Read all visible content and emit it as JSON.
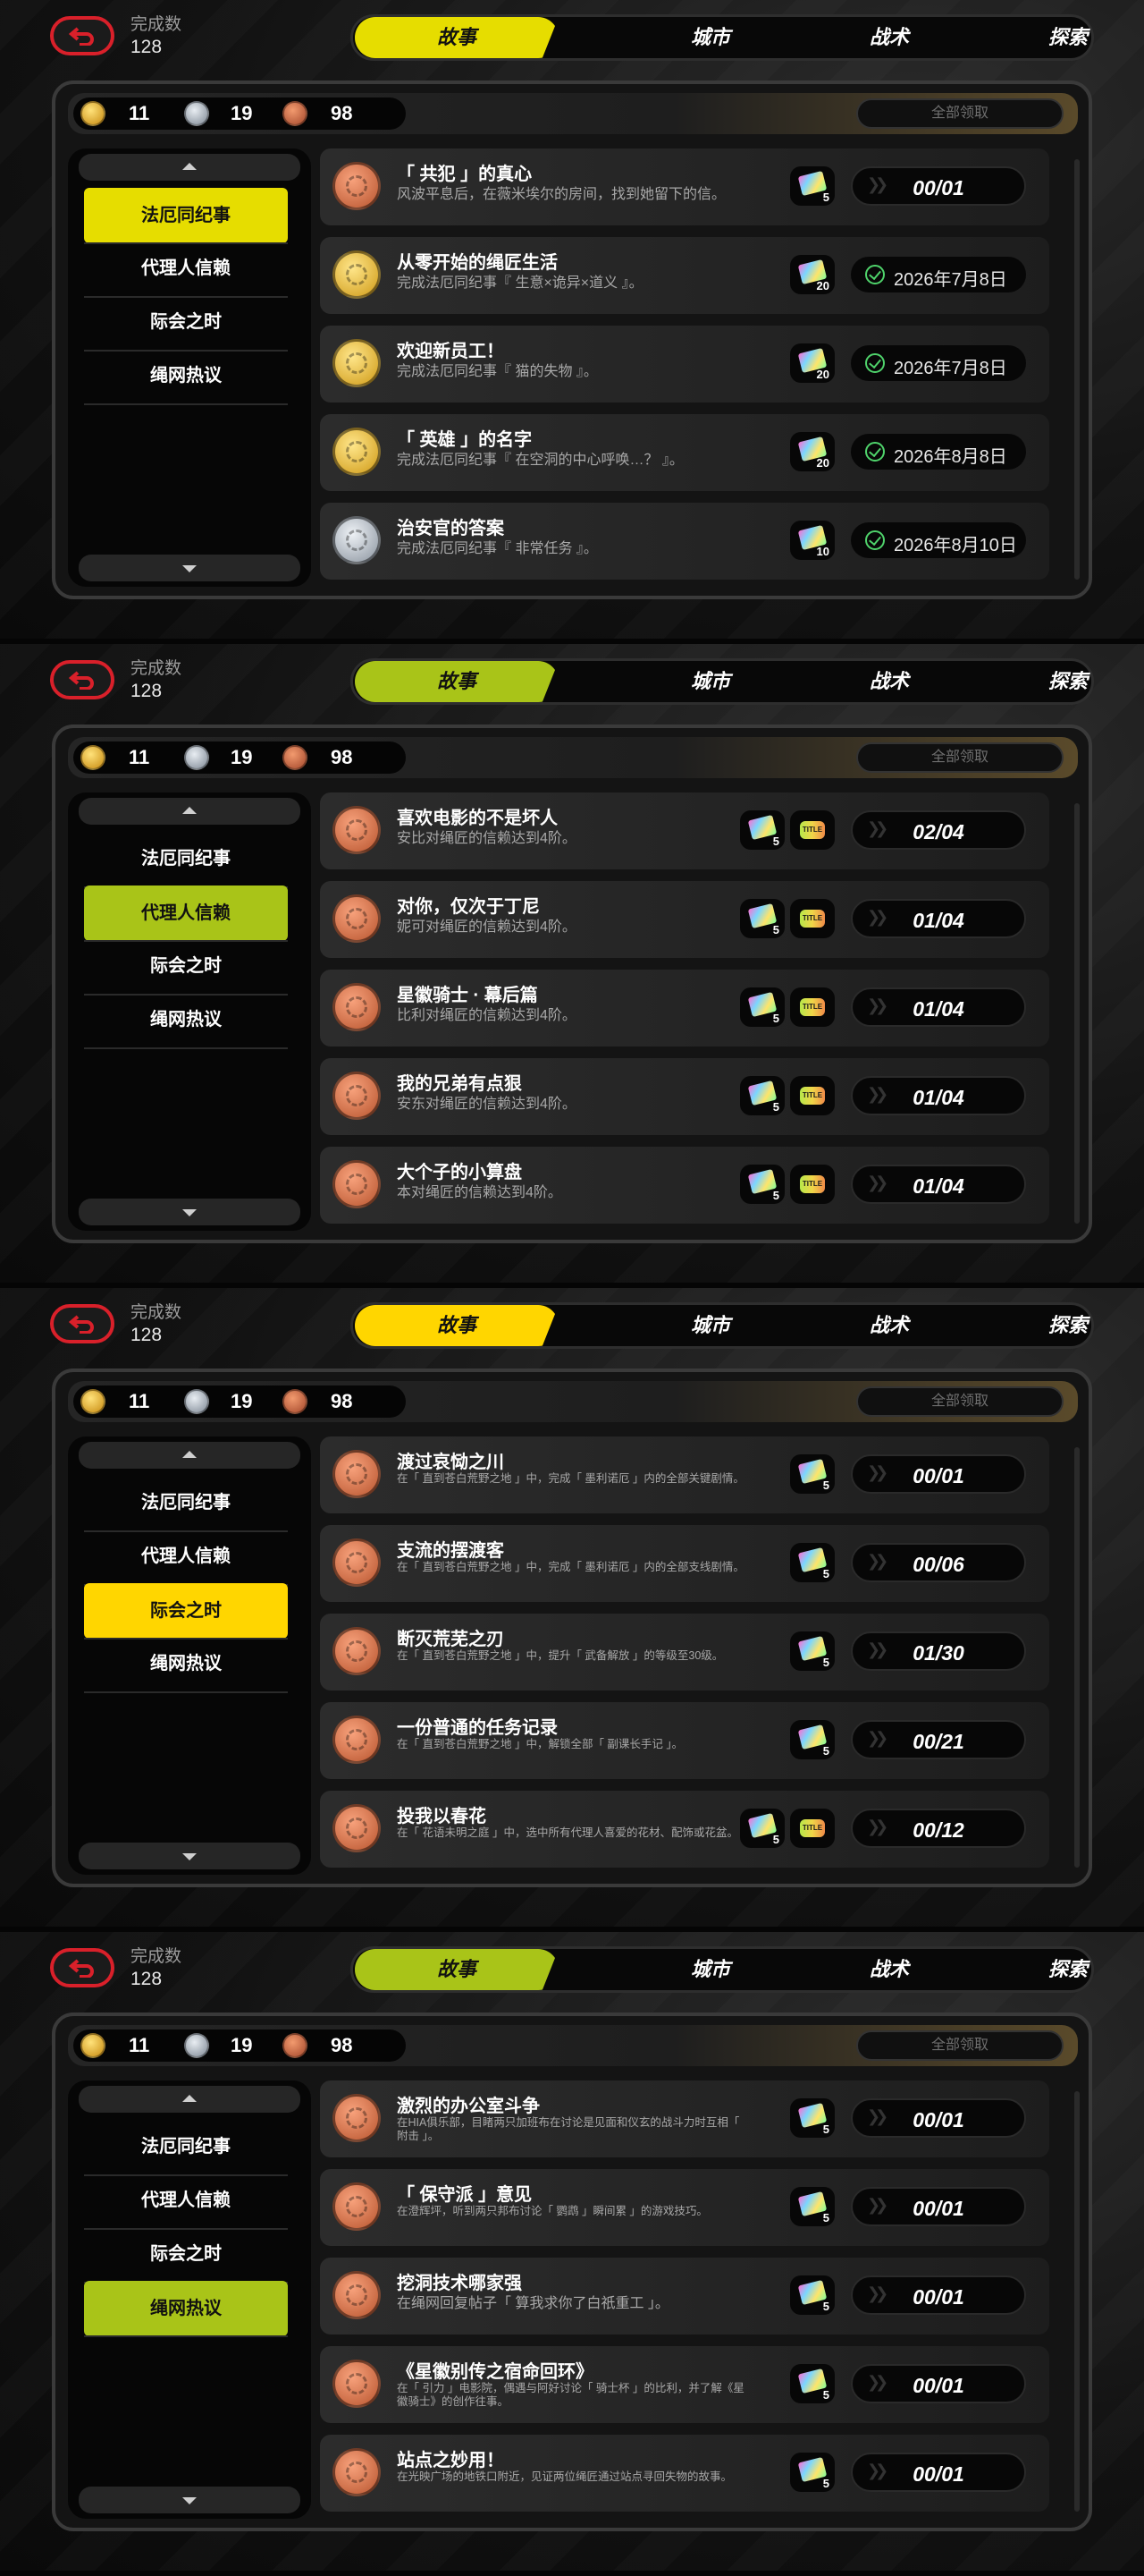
{
  "screens": [
    {
      "accent": "#e6dd00",
      "header": {
        "count_label": "完成数",
        "count_value": "128"
      },
      "tabs": [
        "故事",
        "城市",
        "战术",
        "探索"
      ],
      "active_tab": 0,
      "currency": [
        {
          "icon": "gold-coin-icon",
          "value": "11"
        },
        {
          "icon": "silver-coin-icon",
          "value": "19"
        },
        {
          "icon": "bronze-coin-icon",
          "value": "98"
        }
      ],
      "claim_all": "全部领取",
      "menu": [
        "法厄同纪事",
        "代理人信赖",
        "际会之时",
        "绳网热议"
      ],
      "active_menu": 0,
      "items": [
        {
          "medal": "bronze",
          "title": "「 共犯 」的真心",
          "desc": "风波平息后，在薇米埃尔的房间，找到她留下的信。",
          "rewards": [
            {
              "type": "card",
              "n": "5"
            }
          ],
          "progress": "00/01"
        },
        {
          "medal": "gold",
          "title": "从零开始的绳匠生活",
          "desc": "完成法厄同纪事『 生意×诡异×道义 』。",
          "rewards": [
            {
              "type": "card",
              "n": "20"
            }
          ],
          "done_date": "2026年7月8日"
        },
        {
          "medal": "gold",
          "title": "欢迎新员工！",
          "desc": "完成法厄同纪事『 猫的失物 』。",
          "rewards": [
            {
              "type": "card",
              "n": "20"
            }
          ],
          "done_date": "2026年7月8日"
        },
        {
          "medal": "gold",
          "title": "「 英雄 」的名字",
          "desc": "完成法厄同纪事『 在空洞的中心呼唤…？ 』。",
          "rewards": [
            {
              "type": "card",
              "n": "20"
            }
          ],
          "done_date": "2026年8月8日"
        },
        {
          "medal": "silver",
          "title": "治安官的答案",
          "desc": "完成法厄同纪事『 非常任务 』。",
          "rewards": [
            {
              "type": "card",
              "n": "10"
            }
          ],
          "done_date": "2026年8月10日"
        }
      ]
    },
    {
      "accent": "#a9c418",
      "header": {
        "count_label": "完成数",
        "count_value": "128"
      },
      "tabs": [
        "故事",
        "城市",
        "战术",
        "探索"
      ],
      "active_tab": 0,
      "currency": [
        {
          "icon": "gold-coin-icon",
          "value": "11"
        },
        {
          "icon": "silver-coin-icon",
          "value": "19"
        },
        {
          "icon": "bronze-coin-icon",
          "value": "98"
        }
      ],
      "claim_all": "全部领取",
      "menu": [
        "法厄同纪事",
        "代理人信赖",
        "际会之时",
        "绳网热议"
      ],
      "active_menu": 1,
      "items": [
        {
          "medal": "bronze",
          "title": "喜欢电影的不是坏人",
          "desc": "安比对绳匠的信赖达到4阶。",
          "rewards": [
            {
              "type": "card",
              "n": "5"
            },
            {
              "type": "title",
              "n": ""
            }
          ],
          "progress": "02/04"
        },
        {
          "medal": "bronze",
          "title": "对你，仅次于丁尼",
          "desc": "妮可对绳匠的信赖达到4阶。",
          "rewards": [
            {
              "type": "card",
              "n": "5"
            },
            {
              "type": "title",
              "n": ""
            }
          ],
          "progress": "01/04"
        },
        {
          "medal": "bronze",
          "title": "星徽骑士 · 幕后篇",
          "desc": "比利对绳匠的信赖达到4阶。",
          "rewards": [
            {
              "type": "card",
              "n": "5"
            },
            {
              "type": "title",
              "n": ""
            }
          ],
          "progress": "01/04"
        },
        {
          "medal": "bronze",
          "title": "我的兄弟有点狠",
          "desc": "安东对绳匠的信赖达到4阶。",
          "rewards": [
            {
              "type": "card",
              "n": "5"
            },
            {
              "type": "title",
              "n": ""
            }
          ],
          "progress": "01/04"
        },
        {
          "medal": "bronze",
          "title": "大个子的小算盘",
          "desc": "本对绳匠的信赖达到4阶。",
          "rewards": [
            {
              "type": "card",
              "n": "5"
            },
            {
              "type": "title",
              "n": ""
            }
          ],
          "progress": "01/04"
        }
      ]
    },
    {
      "accent": "#ffd600",
      "header": {
        "count_label": "完成数",
        "count_value": "128"
      },
      "tabs": [
        "故事",
        "城市",
        "战术",
        "探索"
      ],
      "active_tab": 0,
      "currency": [
        {
          "icon": "gold-coin-icon",
          "value": "11"
        },
        {
          "icon": "silver-coin-icon",
          "value": "19"
        },
        {
          "icon": "bronze-coin-icon",
          "value": "98"
        }
      ],
      "claim_all": "全部领取",
      "menu": [
        "法厄同纪事",
        "代理人信赖",
        "际会之时",
        "绳网热议"
      ],
      "active_menu": 2,
      "items": [
        {
          "medal": "bronze",
          "title": "渡过哀恸之川",
          "desc": "在「 直到苍白荒野之地 」中，完成「 墨利诺厄 」内的全部关键剧情。",
          "small": true,
          "rewards": [
            {
              "type": "card",
              "n": "5"
            }
          ],
          "progress": "00/01"
        },
        {
          "medal": "bronze",
          "title": "支流的摆渡客",
          "desc": "在「 直到苍白荒野之地 」中，完成「 墨利诺厄 」内的全部支线剧情。",
          "small": true,
          "rewards": [
            {
              "type": "card",
              "n": "5"
            }
          ],
          "progress": "00/06"
        },
        {
          "medal": "bronze",
          "title": "断灭荒芜之刃",
          "desc": "在「 直到苍白荒野之地 」中，提升「 武备解放 」的等级至30级。",
          "small": true,
          "rewards": [
            {
              "type": "card",
              "n": "5"
            }
          ],
          "progress": "01/30"
        },
        {
          "medal": "bronze",
          "title": "一份普通的任务记录",
          "desc": "在「 直到苍白荒野之地 」中，解锁全部「 副课长手记 」。",
          "small": true,
          "rewards": [
            {
              "type": "card",
              "n": "5"
            }
          ],
          "progress": "00/21"
        },
        {
          "medal": "bronze",
          "title": "投我以春花",
          "desc": "在「 花语未明之庭 」中，选中所有代理人喜爱的花材、配饰或花盆。",
          "small": true,
          "rewards": [
            {
              "type": "card",
              "n": "5"
            },
            {
              "type": "title",
              "n": ""
            }
          ],
          "progress": "00/12"
        }
      ]
    },
    {
      "accent": "#a9c418",
      "header": {
        "count_label": "完成数",
        "count_value": "128"
      },
      "tabs": [
        "故事",
        "城市",
        "战术",
        "探索"
      ],
      "active_tab": 0,
      "currency": [
        {
          "icon": "gold-coin-icon",
          "value": "11"
        },
        {
          "icon": "silver-coin-icon",
          "value": "19"
        },
        {
          "icon": "bronze-coin-icon",
          "value": "98"
        }
      ],
      "claim_all": "全部领取",
      "menu": [
        "法厄同纪事",
        "代理人信赖",
        "际会之时",
        "绳网热议"
      ],
      "active_menu": 3,
      "items": [
        {
          "medal": "bronze",
          "title": "激烈的办公室斗争",
          "desc": "在HIA俱乐部，目睹两只加班布在讨论是见面和仪玄的战斗力时互相「 附击 」。",
          "small": true,
          "rewards": [
            {
              "type": "card",
              "n": "5"
            }
          ],
          "progress": "00/01"
        },
        {
          "medal": "bronze",
          "title": "「 保守派 」意见",
          "desc": "在澄辉坪，听到两只邦布讨论「 鹦鹉 」瞬间累 」的游戏技巧。",
          "small": true,
          "rewards": [
            {
              "type": "card",
              "n": "5"
            }
          ],
          "progress": "00/01"
        },
        {
          "medal": "bronze",
          "title": "挖洞技术哪家强",
          "desc": "在绳网回复帖子「 算我求你了白祇重工 」。",
          "rewards": [
            {
              "type": "card",
              "n": "5"
            }
          ],
          "progress": "00/01"
        },
        {
          "medal": "bronze",
          "title": "《星徽别传之宿命回环》",
          "desc": "在「 引力 」电影院，偶遇与阿好讨论「 骑士杯 」的比利，并了解《星徽骑士》的创作往事。",
          "small": true,
          "rewards": [
            {
              "type": "card",
              "n": "5"
            }
          ],
          "progress": "00/01"
        },
        {
          "medal": "bronze",
          "title": "站点之妙用！",
          "desc": "在光映广场的地铁口附近，见证两位绳匠通过站点寻回失物的故事。",
          "small": true,
          "rewards": [
            {
              "type": "card",
              "n": "5"
            }
          ],
          "progress": "00/01"
        }
      ]
    }
  ]
}
